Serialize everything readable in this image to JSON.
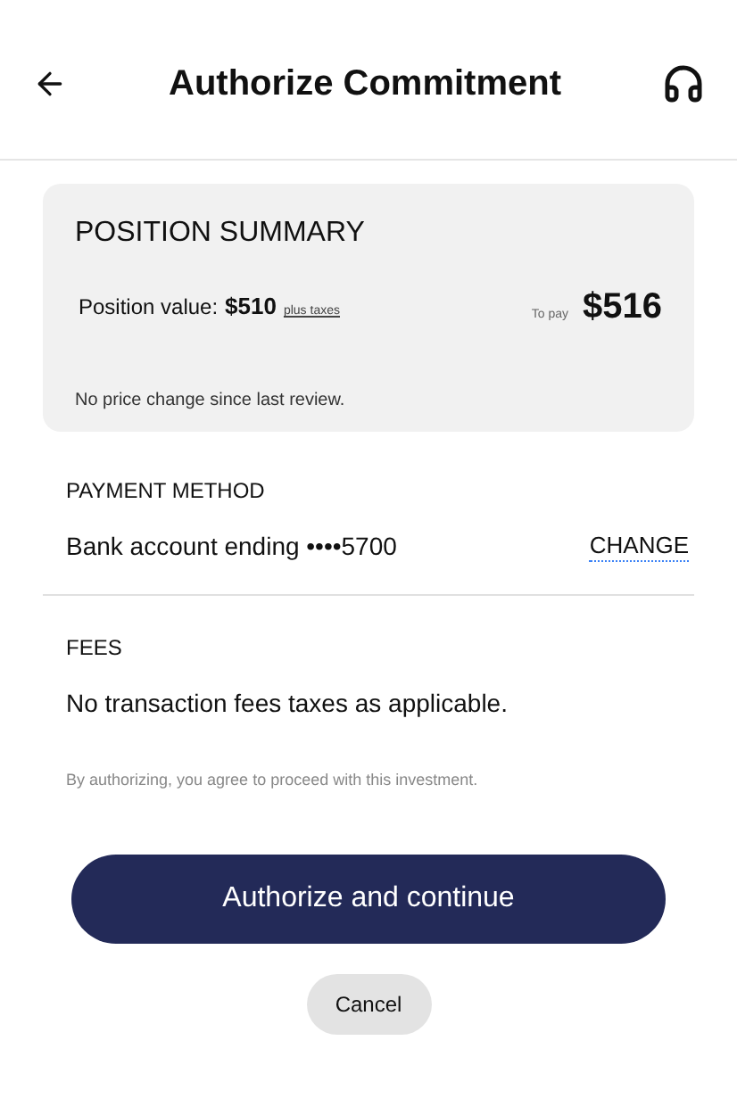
{
  "header": {
    "title": "Authorize Commitment"
  },
  "summary": {
    "title": "POSITION SUMMARY",
    "value_label": "Position value:",
    "value": "$510",
    "taxes_link": "plus taxes",
    "to_pay_label": "To pay",
    "to_pay": "$516",
    "note": "No price change since last review."
  },
  "payment": {
    "label": "PAYMENT METHOD",
    "account": "Bank account ending ••••5700",
    "change": "CHANGE"
  },
  "fees": {
    "label": "FEES",
    "text": "No transaction fees taxes as applicable."
  },
  "disclaimer": "By authorizing, you agree to proceed with this investment.",
  "buttons": {
    "primary": "Authorize and continue",
    "secondary": "Cancel"
  }
}
